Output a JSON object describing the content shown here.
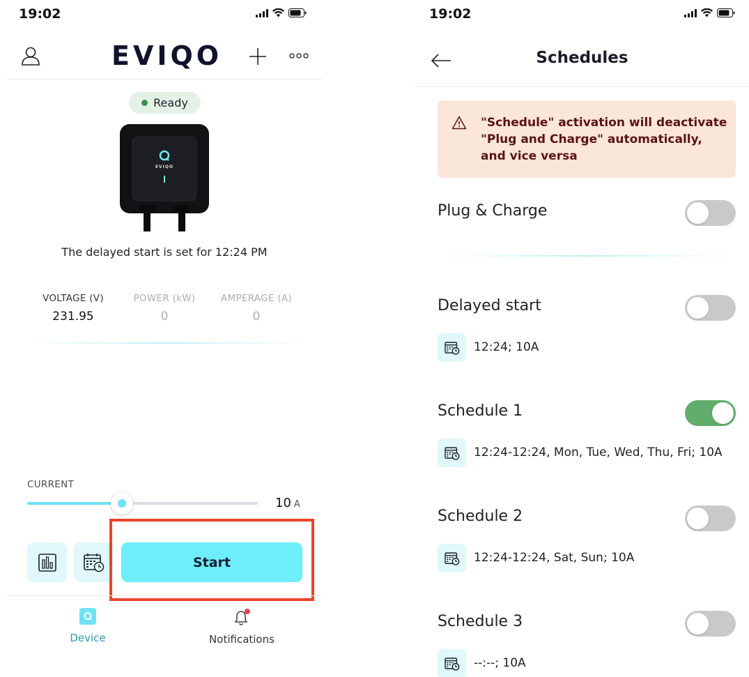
{
  "left_screen": {
    "status": {
      "time": "19:02"
    },
    "header": {
      "logo_text": "EVIQO"
    },
    "status_badge": {
      "label": "Ready",
      "color": "#3c8d4f"
    },
    "device_logo_text": "EVIQO",
    "delay_message": "The delayed start is set for 12:24 PM",
    "stats": [
      {
        "label": "VOLTAGE (V)",
        "value": "231.95",
        "active": true
      },
      {
        "label": "POWER (kW)",
        "value": "0",
        "active": false
      },
      {
        "label": "AMPERAGE (A)",
        "value": "0",
        "active": false
      }
    ],
    "current": {
      "label": "CURRENT",
      "value": "10",
      "unit": "A",
      "fraction": 0.41
    },
    "start_button": {
      "label": "Start",
      "color": "#6eeefa"
    },
    "highlight_color": "#e8452c",
    "tabs": [
      {
        "label": "Device",
        "icon": "device-icon",
        "active": true
      },
      {
        "label": "Notifications",
        "icon": "bell-icon",
        "badge": true
      }
    ]
  },
  "right_screen": {
    "status": {
      "time": "19:02"
    },
    "title": "Schedules",
    "warning": {
      "lines": [
        "\"Schedule\" activation will deactivate",
        "\"Plug and Charge\" automatically,",
        "and vice versa"
      ]
    },
    "plug_and_charge": {
      "label": "Plug & Charge",
      "enabled": false
    },
    "delayed_start": {
      "label": "Delayed start",
      "enabled": false,
      "detail": "12:24; 10A"
    },
    "schedules": [
      {
        "label": "Schedule 1",
        "enabled": true,
        "detail": "12:24-12:24, Mon, Tue, Wed, Thu, Fri; 10A"
      },
      {
        "label": "Schedule 2",
        "enabled": false,
        "detail": "12:24-12:24, Sat, Sun; 10A"
      },
      {
        "label": "Schedule 3",
        "enabled": false,
        "detail": "--:--; 10A"
      }
    ],
    "toggle_on_color": "#62ad6c"
  }
}
